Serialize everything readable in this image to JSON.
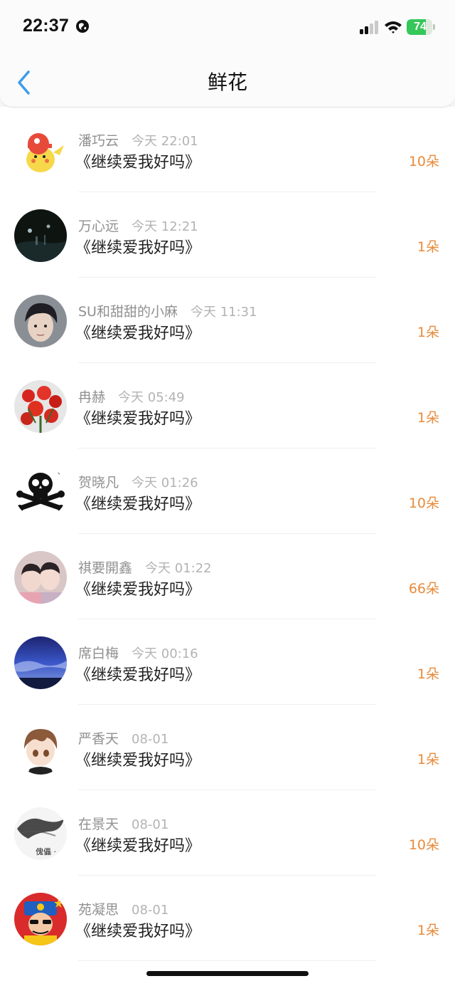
{
  "status_bar": {
    "time": "22:37",
    "battery": "74",
    "battery_level": 0.74,
    "icons": [
      "globe-icon",
      "signal-icon",
      "wifi-icon",
      "battery-icon"
    ]
  },
  "nav": {
    "title": "鲜花",
    "back_icon": "chevron-left-icon"
  },
  "colors": {
    "accent_back": "#3d9be9",
    "count": "#e98a3a",
    "battery_fill": "#35c759"
  },
  "rows": [
    {
      "name": "潘巧云",
      "time": "今天 22:01",
      "song": "《继续爱我好吗》",
      "count": "10朵",
      "avatar": "pikachu-avatar"
    },
    {
      "name": "万心远",
      "time": "今天 12:21",
      "song": "《继续爱我好吗》",
      "count": "1朵",
      "avatar": "night-scene-avatar"
    },
    {
      "name": "SU和甜甜的小麻",
      "time": "今天 11:31",
      "song": "《继续爱我好吗》",
      "count": "1朵",
      "avatar": "portrait-avatar"
    },
    {
      "name": "冉赫",
      "time": "今天 05:49",
      "song": "《继续爱我好吗》",
      "count": "1朵",
      "avatar": "flowers-avatar"
    },
    {
      "name": "贺晓凡",
      "time": "今天 01:26",
      "song": "《继续爱我好吗》",
      "count": "10朵",
      "avatar": "skull-avatar"
    },
    {
      "name": "祺要開鑫",
      "time": "今天 01:22",
      "song": "《继续爱我好吗》",
      "count": "66朵",
      "avatar": "two-people-avatar"
    },
    {
      "name": "席白梅",
      "time": "今天 00:16",
      "song": "《继续爱我好吗》",
      "count": "1朵",
      "avatar": "sky-avatar"
    },
    {
      "name": "严香天",
      "time": "08-01",
      "song": "《继续爱我好吗》",
      "count": "1朵",
      "avatar": "anime-avatar"
    },
    {
      "name": "在景天",
      "time": "08-01",
      "song": "《继续爱我好吗》",
      "count": "10朵",
      "avatar": "ink-avatar",
      "avatar_text": "傀儡 ·"
    },
    {
      "name": "苑凝思",
      "time": "08-01",
      "song": "《继续爱我好吗》",
      "count": "1朵",
      "avatar": "fortune-god-avatar"
    }
  ]
}
